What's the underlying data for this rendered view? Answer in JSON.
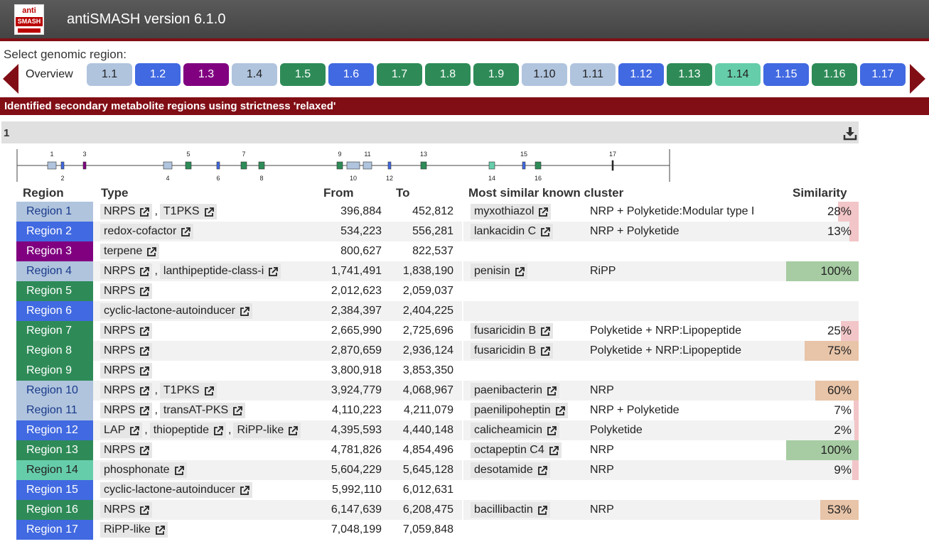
{
  "app": {
    "logo_top": "anti",
    "logo_bottom": "SMASH",
    "title": "antiSMASH version 6.1.0"
  },
  "nav": {
    "select_label": "Select genomic region:",
    "overview_label": "Overview",
    "regions": [
      {
        "label": "1.1",
        "color": "#b0c4de",
        "fg": "#222"
      },
      {
        "label": "1.2",
        "color": "#4169e1",
        "fg": "#fff"
      },
      {
        "label": "1.3",
        "color": "#800080",
        "fg": "#fff"
      },
      {
        "label": "1.4",
        "color": "#b0c4de",
        "fg": "#222"
      },
      {
        "label": "1.5",
        "color": "#2e8b57",
        "fg": "#fff"
      },
      {
        "label": "1.6",
        "color": "#4169e1",
        "fg": "#fff"
      },
      {
        "label": "1.7",
        "color": "#2e8b57",
        "fg": "#fff"
      },
      {
        "label": "1.8",
        "color": "#2e8b57",
        "fg": "#fff"
      },
      {
        "label": "1.9",
        "color": "#2e8b57",
        "fg": "#fff"
      },
      {
        "label": "1.10",
        "color": "#b0c4de",
        "fg": "#222"
      },
      {
        "label": "1.11",
        "color": "#b0c4de",
        "fg": "#222"
      },
      {
        "label": "1.12",
        "color": "#4169e1",
        "fg": "#fff"
      },
      {
        "label": "1.13",
        "color": "#2e8b57",
        "fg": "#fff"
      },
      {
        "label": "1.14",
        "color": "#66cdaa",
        "fg": "#222"
      },
      {
        "label": "1.15",
        "color": "#4169e1",
        "fg": "#fff"
      },
      {
        "label": "1.16",
        "color": "#2e8b57",
        "fg": "#fff"
      },
      {
        "label": "1.17",
        "color": "#4169e1",
        "fg": "#fff"
      }
    ]
  },
  "banner": "Identified secondary metabolite regions using strictness 'relaxed'",
  "record": {
    "name": "1"
  },
  "overview_markers": [
    {
      "label": "1",
      "kind": "big",
      "color": "#b0c4de"
    },
    {
      "label": "2",
      "kind": "small",
      "color": "#4169e1"
    },
    {
      "label": "3",
      "kind": "small",
      "color": "#800080"
    },
    {
      "label": "4",
      "kind": "big",
      "color": "#b0c4de"
    },
    {
      "label": "5",
      "kind": "mid",
      "color": "#2e8b57"
    },
    {
      "label": "6",
      "kind": "small",
      "color": "#4169e1"
    },
    {
      "label": "7",
      "kind": "mid",
      "color": "#2e8b57"
    },
    {
      "label": "8",
      "kind": "mid",
      "color": "#2e8b57"
    },
    {
      "label": "9",
      "kind": "mid",
      "color": "#2e8b57"
    },
    {
      "label": "10",
      "kind": "big",
      "color": "#b0c4de"
    },
    {
      "label": "11",
      "kind": "big",
      "color": "#b0c4de"
    },
    {
      "label": "12",
      "kind": "small",
      "color": "#4169e1"
    },
    {
      "label": "13",
      "kind": "mid",
      "color": "#2e8b57"
    },
    {
      "label": "14",
      "kind": "mid",
      "color": "#66cdaa"
    },
    {
      "label": "15",
      "kind": "small",
      "color": "#4169e1"
    },
    {
      "label": "16",
      "kind": "mid",
      "color": "#2e8b57"
    },
    {
      "label": "17",
      "kind": "tick",
      "color": "#222"
    }
  ],
  "table": {
    "headers": {
      "region": "Region",
      "type": "Type",
      "from": "From",
      "to": "To",
      "cluster": "Most similar known cluster",
      "similarity": "Similarity"
    },
    "rows": [
      {
        "region": "Region 1",
        "color": "#b0c4de",
        "fg": "#1a3a8a",
        "types": [
          "NRPS",
          "T1PKS"
        ],
        "from": "396,884",
        "to": "452,812",
        "cluster": "myxothiazol",
        "ctype": "NRP + Polyketide:Modular type I",
        "similarity": "28%",
        "sim_pct": 28
      },
      {
        "region": "Region 2",
        "color": "#4169e1",
        "fg": "#fff",
        "types": [
          "redox-cofactor"
        ],
        "from": "534,223",
        "to": "556,281",
        "cluster": "lankacidin C",
        "ctype": "NRP + Polyketide",
        "similarity": "13%",
        "sim_pct": 13
      },
      {
        "region": "Region 3",
        "color": "#800080",
        "fg": "#fff",
        "types": [
          "terpene"
        ],
        "from": "800,627",
        "to": "822,537",
        "cluster": "",
        "ctype": "",
        "similarity": "",
        "sim_pct": 0
      },
      {
        "region": "Region 4",
        "color": "#b0c4de",
        "fg": "#1a3a8a",
        "types": [
          "NRPS",
          "lanthipeptide-class-i"
        ],
        "from": "1,741,491",
        "to": "1,838,190",
        "cluster": "penisin",
        "ctype": "RiPP",
        "similarity": "100%",
        "sim_pct": 100
      },
      {
        "region": "Region 5",
        "color": "#2e8b57",
        "fg": "#fff",
        "types": [
          "NRPS"
        ],
        "from": "2,012,623",
        "to": "2,059,037",
        "cluster": "",
        "ctype": "",
        "similarity": "",
        "sim_pct": 0
      },
      {
        "region": "Region 6",
        "color": "#4169e1",
        "fg": "#fff",
        "types": [
          "cyclic-lactone-autoinducer"
        ],
        "from": "2,384,397",
        "to": "2,404,225",
        "cluster": "",
        "ctype": "",
        "similarity": "",
        "sim_pct": 0
      },
      {
        "region": "Region 7",
        "color": "#2e8b57",
        "fg": "#fff",
        "types": [
          "NRPS"
        ],
        "from": "2,665,990",
        "to": "2,725,696",
        "cluster": "fusaricidin B",
        "ctype": "Polyketide + NRP:Lipopeptide",
        "similarity": "25%",
        "sim_pct": 25
      },
      {
        "region": "Region 8",
        "color": "#2e8b57",
        "fg": "#fff",
        "types": [
          "NRPS"
        ],
        "from": "2,870,659",
        "to": "2,936,124",
        "cluster": "fusaricidin B",
        "ctype": "Polyketide + NRP:Lipopeptide",
        "similarity": "75%",
        "sim_pct": 75
      },
      {
        "region": "Region 9",
        "color": "#2e8b57",
        "fg": "#fff",
        "types": [
          "NRPS"
        ],
        "from": "3,800,918",
        "to": "3,853,350",
        "cluster": "",
        "ctype": "",
        "similarity": "",
        "sim_pct": 0
      },
      {
        "region": "Region 10",
        "color": "#b0c4de",
        "fg": "#1a3a8a",
        "types": [
          "NRPS",
          "T1PKS"
        ],
        "from": "3,924,779",
        "to": "4,068,967",
        "cluster": "paenibacterin",
        "ctype": "NRP",
        "similarity": "60%",
        "sim_pct": 60
      },
      {
        "region": "Region 11",
        "color": "#b0c4de",
        "fg": "#1a3a8a",
        "types": [
          "NRPS",
          "transAT-PKS"
        ],
        "from": "4,110,223",
        "to": "4,211,079",
        "cluster": "paenilipoheptin",
        "ctype": "NRP + Polyketide",
        "similarity": "7%",
        "sim_pct": 7
      },
      {
        "region": "Region 12",
        "color": "#4169e1",
        "fg": "#fff",
        "types": [
          "LAP",
          "thiopeptide",
          "RiPP-like"
        ],
        "from": "4,395,593",
        "to": "4,440,148",
        "cluster": "calicheamicin",
        "ctype": "Polyketide",
        "similarity": "2%",
        "sim_pct": 2
      },
      {
        "region": "Region 13",
        "color": "#2e8b57",
        "fg": "#fff",
        "types": [
          "NRPS"
        ],
        "from": "4,781,826",
        "to": "4,854,496",
        "cluster": "octapeptin C4",
        "ctype": "NRP",
        "similarity": "100%",
        "sim_pct": 100
      },
      {
        "region": "Region 14",
        "color": "#66cdaa",
        "fg": "#222",
        "types": [
          "phosphonate"
        ],
        "from": "5,604,229",
        "to": "5,645,128",
        "cluster": "desotamide",
        "ctype": "NRP",
        "similarity": "9%",
        "sim_pct": 9
      },
      {
        "region": "Region 15",
        "color": "#4169e1",
        "fg": "#fff",
        "types": [
          "cyclic-lactone-autoinducer"
        ],
        "from": "5,992,110",
        "to": "6,012,631",
        "cluster": "",
        "ctype": "",
        "similarity": "",
        "sim_pct": 0
      },
      {
        "region": "Region 16",
        "color": "#2e8b57",
        "fg": "#fff",
        "types": [
          "NRPS"
        ],
        "from": "6,147,639",
        "to": "6,208,475",
        "cluster": "bacillibactin",
        "ctype": "NRP",
        "similarity": "53%",
        "sim_pct": 53
      },
      {
        "region": "Region 17",
        "color": "#4169e1",
        "fg": "#fff",
        "types": [
          "RiPP-like"
        ],
        "from": "7,048,199",
        "to": "7,059,848",
        "cluster": "",
        "ctype": "",
        "similarity": "",
        "sim_pct": 0
      }
    ]
  },
  "colors": {
    "brand": "#810e15",
    "sim_high": "#a7cca3",
    "sim_mid": "#e8c4a8",
    "sim_low": "#f2c6c8"
  }
}
